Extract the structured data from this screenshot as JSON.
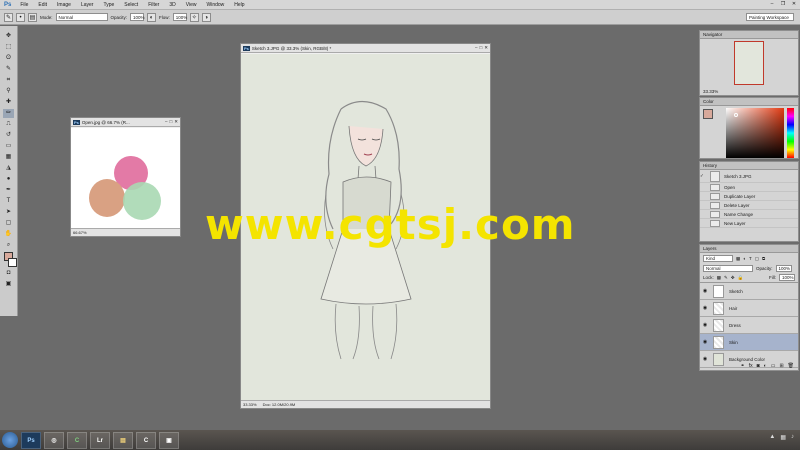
{
  "app": {
    "logo": "Ps",
    "menu": [
      "File",
      "Edit",
      "Image",
      "Layer",
      "Type",
      "Select",
      "Filter",
      "3D",
      "View",
      "Window",
      "Help"
    ]
  },
  "options": {
    "mode_label": "Mode:",
    "mode_value": "Normal",
    "opacity_label": "Opacity:",
    "opacity_value": "100%",
    "flow_label": "Flow:",
    "flow_value": "100%",
    "workspace": "Painting Workspace"
  },
  "doc_small": {
    "title": "Open.jpg @ 66.7% (R...",
    "zoom": "66.67%"
  },
  "doc_main": {
    "title": "Sketch 3.JPG @ 33.3% (Skin, RGB/8) *",
    "zoom": "33.33%",
    "doc_info": "Doc: 12.0M/20.9M"
  },
  "navigator": {
    "title": "Navigator",
    "zoom": "33.33%"
  },
  "color_panel": {
    "title": "Color"
  },
  "history": {
    "title": "History",
    "snapshot": "Sketch 3.JPG",
    "items": [
      "Open",
      "Duplicate Layer",
      "Delete Layer",
      "Name Change",
      "New Layer"
    ]
  },
  "layers": {
    "title": "Layers",
    "kind": "Kind",
    "blend": "Normal",
    "opacity_label": "Opacity:",
    "opacity_value": "100%",
    "lock_label": "Lock:",
    "fill_label": "Fill:",
    "fill_value": "100%",
    "items": [
      {
        "name": "Sketch",
        "thumb": "white"
      },
      {
        "name": "Hair",
        "thumb": "checker"
      },
      {
        "name": "Dress",
        "thumb": "checker"
      },
      {
        "name": "Skin",
        "thumb": "checker"
      },
      {
        "name": "Background Color",
        "thumb": "fill"
      }
    ]
  },
  "watermark": "www.cgtsj.com",
  "colors": {
    "swatch_pink": "#e37aa6",
    "swatch_peach": "#d9a183",
    "swatch_mint": "#a8d8b2",
    "canvas_bg": "#e2e6dc",
    "fg_color": "#d8a99b"
  }
}
